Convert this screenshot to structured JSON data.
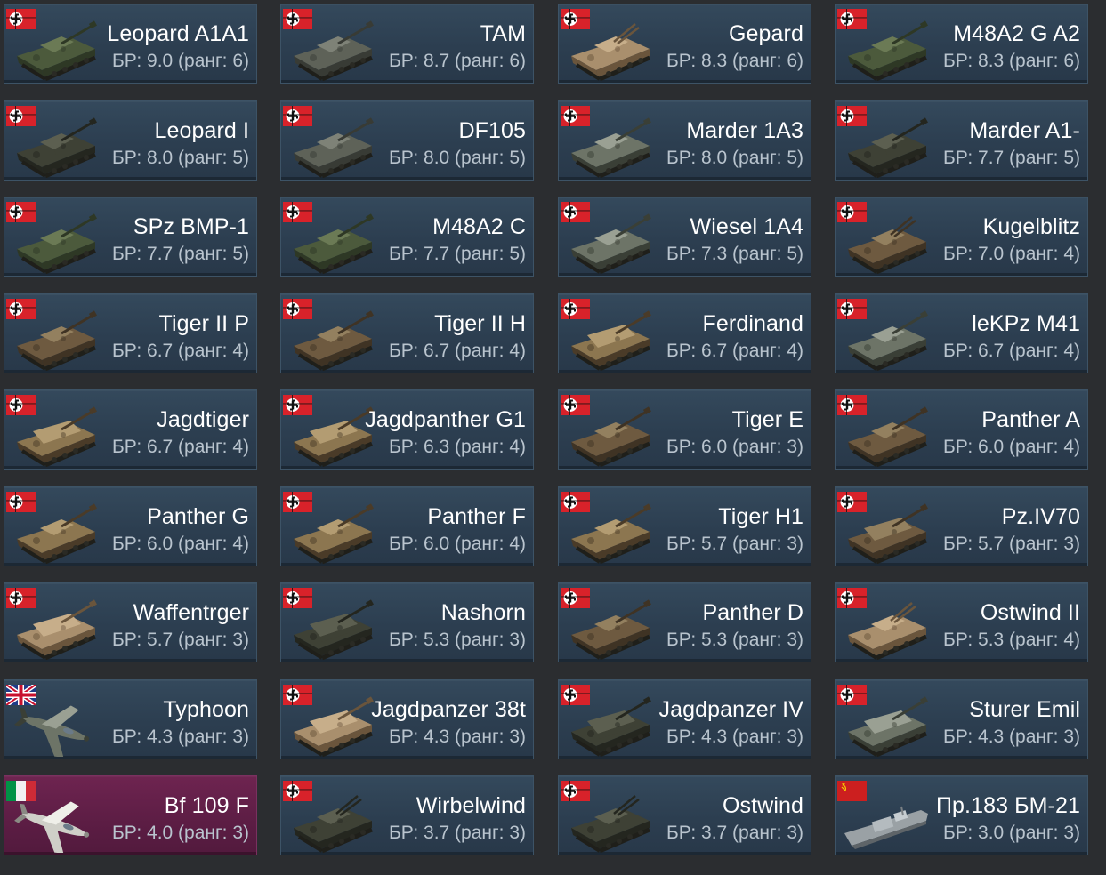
{
  "br_prefix": "БР:",
  "rank_word": "ранг:",
  "colors": {
    "background": "#2b2d30",
    "card": "#2f4254",
    "card_premium": "#5c1d44",
    "name_text": "#ffffff",
    "br_text": "#b9c4ce"
  },
  "vehicles": [
    {
      "name": "Leopard A1A1",
      "br": "9.0",
      "rank": "6",
      "nation": "germany",
      "type": "tank",
      "camo": "green",
      "premium": false
    },
    {
      "name": "TAM",
      "br": "8.7",
      "rank": "6",
      "nation": "germany",
      "type": "tank",
      "camo": "grey",
      "premium": false
    },
    {
      "name": "Gepard",
      "br": "8.3",
      "rank": "6",
      "nation": "germany",
      "type": "spaa",
      "camo": "sand",
      "premium": false
    },
    {
      "name": "M48A2 G A2",
      "br": "8.3",
      "rank": "6",
      "nation": "germany",
      "type": "tank",
      "camo": "green",
      "premium": false
    },
    {
      "name": "Leopard I",
      "br": "8.0",
      "rank": "5",
      "nation": "germany",
      "type": "tank",
      "camo": "dark",
      "premium": false
    },
    {
      "name": "DF105",
      "br": "8.0",
      "rank": "5",
      "nation": "germany",
      "type": "tank",
      "camo": "grey",
      "premium": false
    },
    {
      "name": "Marder 1A3",
      "br": "8.0",
      "rank": "5",
      "nation": "germany",
      "type": "ifv",
      "camo": "greycamo",
      "premium": false
    },
    {
      "name": "Marder A1-",
      "br": "7.7",
      "rank": "5",
      "nation": "germany",
      "type": "ifv",
      "camo": "dark",
      "premium": false
    },
    {
      "name": "SPz BMP-1",
      "br": "7.7",
      "rank": "5",
      "nation": "germany",
      "type": "ifv",
      "camo": "green",
      "premium": false
    },
    {
      "name": "M48A2 C",
      "br": "7.7",
      "rank": "5",
      "nation": "germany",
      "type": "tank",
      "camo": "green",
      "premium": false
    },
    {
      "name": "Wiesel 1A4",
      "br": "7.3",
      "rank": "5",
      "nation": "germany",
      "type": "ifv",
      "camo": "greycamo",
      "premium": false
    },
    {
      "name": "Kugelblitz",
      "br": "7.0",
      "rank": "4",
      "nation": "germany",
      "type": "spaa",
      "camo": "brown",
      "premium": false
    },
    {
      "name": "Tiger II P",
      "br": "6.7",
      "rank": "4",
      "nation": "germany",
      "type": "tank",
      "camo": "brown",
      "premium": false
    },
    {
      "name": "Tiger II H",
      "br": "6.7",
      "rank": "4",
      "nation": "germany",
      "type": "tank",
      "camo": "brown",
      "premium": false
    },
    {
      "name": "Ferdinand",
      "br": "6.7",
      "rank": "4",
      "nation": "germany",
      "type": "td",
      "camo": "camo",
      "premium": false
    },
    {
      "name": "leKPz M41",
      "br": "6.7",
      "rank": "4",
      "nation": "germany",
      "type": "tank",
      "camo": "greycamo",
      "premium": false
    },
    {
      "name": "Jagdtiger",
      "br": "6.7",
      "rank": "4",
      "nation": "germany",
      "type": "td",
      "camo": "camo",
      "premium": false
    },
    {
      "name": "Jagdpanther G1",
      "br": "6.3",
      "rank": "4",
      "nation": "germany",
      "type": "td",
      "camo": "camo",
      "premium": false
    },
    {
      "name": "Tiger E",
      "br": "6.0",
      "rank": "3",
      "nation": "germany",
      "type": "tank",
      "camo": "brown",
      "premium": false
    },
    {
      "name": "Panther A",
      "br": "6.0",
      "rank": "4",
      "nation": "germany",
      "type": "tank",
      "camo": "brown",
      "premium": false
    },
    {
      "name": "Panther G",
      "br": "6.0",
      "rank": "4",
      "nation": "germany",
      "type": "tank",
      "camo": "camo",
      "premium": false
    },
    {
      "name": "Panther F",
      "br": "6.0",
      "rank": "4",
      "nation": "germany",
      "type": "tank",
      "camo": "camo",
      "premium": false
    },
    {
      "name": "Tiger H1",
      "br": "5.7",
      "rank": "3",
      "nation": "germany",
      "type": "tank",
      "camo": "camo",
      "premium": false
    },
    {
      "name": "Pz.IV70",
      "br": "5.7",
      "rank": "3",
      "nation": "germany",
      "type": "td",
      "camo": "brown",
      "premium": false
    },
    {
      "name": "Waffentrger",
      "br": "5.7",
      "rank": "3",
      "nation": "germany",
      "type": "td",
      "camo": "sand",
      "premium": false
    },
    {
      "name": "Nashorn",
      "br": "5.3",
      "rank": "3",
      "nation": "germany",
      "type": "td",
      "camo": "dark",
      "premium": false
    },
    {
      "name": "Panther D",
      "br": "5.3",
      "rank": "3",
      "nation": "germany",
      "type": "tank",
      "camo": "brown",
      "premium": false
    },
    {
      "name": "Ostwind II",
      "br": "5.3",
      "rank": "4",
      "nation": "germany",
      "type": "spaa",
      "camo": "sand",
      "premium": false
    },
    {
      "name": "Typhoon",
      "br": "4.3",
      "rank": "3",
      "nation": "britain",
      "type": "plane",
      "camo": "greycamo",
      "premium": false
    },
    {
      "name": "Jagdpanzer 38t",
      "br": "4.3",
      "rank": "3",
      "nation": "germany",
      "type": "td",
      "camo": "sand",
      "premium": false
    },
    {
      "name": "Jagdpanzer IV",
      "br": "4.3",
      "rank": "3",
      "nation": "germany",
      "type": "td",
      "camo": "dark",
      "premium": false
    },
    {
      "name": "Sturer Emil",
      "br": "4.3",
      "rank": "3",
      "nation": "germany",
      "type": "td",
      "camo": "greycamo",
      "premium": false
    },
    {
      "name": "Bf 109 F",
      "br": "4.0",
      "rank": "3",
      "nation": "italy",
      "type": "plane",
      "camo": "light",
      "premium": true
    },
    {
      "name": "Wirbelwind",
      "br": "3.7",
      "rank": "3",
      "nation": "germany",
      "type": "spaa",
      "camo": "dark",
      "premium": false
    },
    {
      "name": "Ostwind",
      "br": "3.7",
      "rank": "3",
      "nation": "germany",
      "type": "spaa",
      "camo": "dark",
      "premium": false
    },
    {
      "name": "Пр.183 БМ-21",
      "br": "3.0",
      "rank": "3",
      "nation": "ussr",
      "type": "boat",
      "camo": "grey",
      "premium": false
    }
  ]
}
